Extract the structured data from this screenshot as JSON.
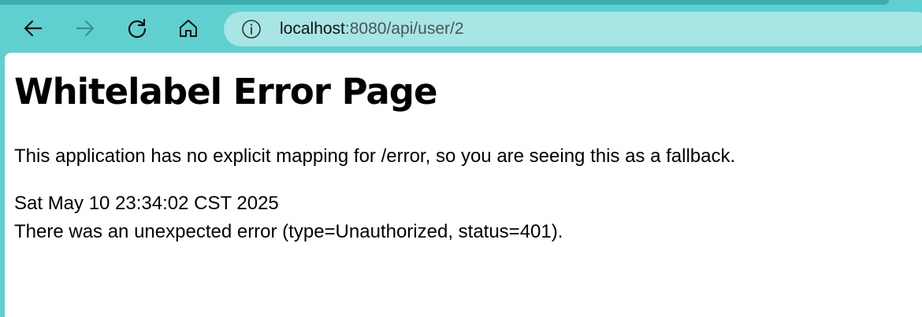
{
  "toolbar": {
    "back_icon": "arrow-left-icon",
    "forward_icon": "arrow-right-icon",
    "reload_icon": "reload-icon",
    "home_icon": "home-icon",
    "accent_color": "#5fd0cf",
    "address_bar_color": "#a8e5e5"
  },
  "address": {
    "info_icon": "info-icon",
    "host": "localhost",
    "path": ":8080/api/user/2"
  },
  "page": {
    "title": "Whitelabel Error Page",
    "explanation": "This application has no explicit mapping for /error, so you are seeing this as a fallback.",
    "timestamp": "Sat May 10 23:34:02 CST 2025",
    "error_message": "There was an unexpected error (type=Unauthorized, status=401)."
  }
}
